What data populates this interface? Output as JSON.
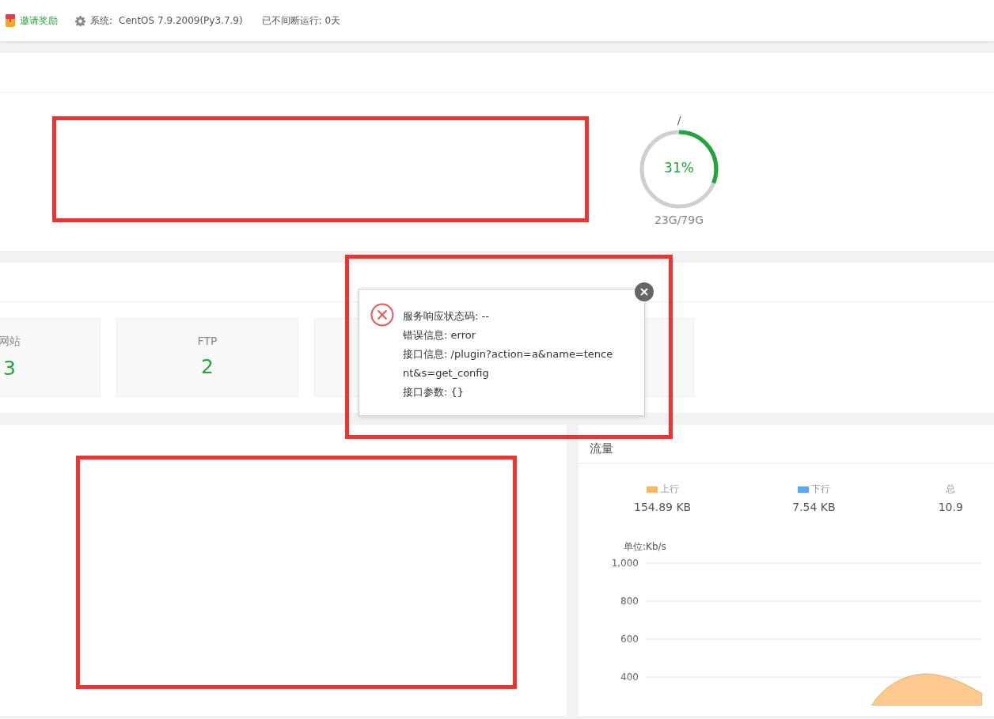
{
  "top_bar": {
    "invite": {
      "label": "邀请奖励"
    },
    "system": {
      "label": "系统:",
      "value": "CentOS 7.9.2009(Py3.7.9)"
    },
    "uptime": "已不间断运行: 0天"
  },
  "disk": {
    "mount": "/",
    "percent": "31%",
    "level": 0.31,
    "usage": "23G/79G"
  },
  "stats": [
    {
      "label": "网站",
      "value": "3"
    },
    {
      "label": "FTP",
      "value": "2"
    }
  ],
  "traffic": {
    "title": "流量",
    "legend": [
      {
        "label": "上行",
        "value": "154.89 KB",
        "color": "#f6b858"
      },
      {
        "label": "下行",
        "value": "7.54 KB",
        "color": "#52a9ff"
      },
      {
        "label": "总",
        "value": "10.9"
      }
    ],
    "graph": {
      "unit": "单位:Kb/s",
      "tick_labels": [
        "1,000",
        "800",
        "600",
        "400"
      ]
    }
  },
  "error_dialog": {
    "lines": [
      "服务响应状态码: --",
      "错误信息: error",
      "接口信息: /plugin?action=a&name=tence",
      "nt&s=get_config",
      "接口参数: {}"
    ]
  }
}
